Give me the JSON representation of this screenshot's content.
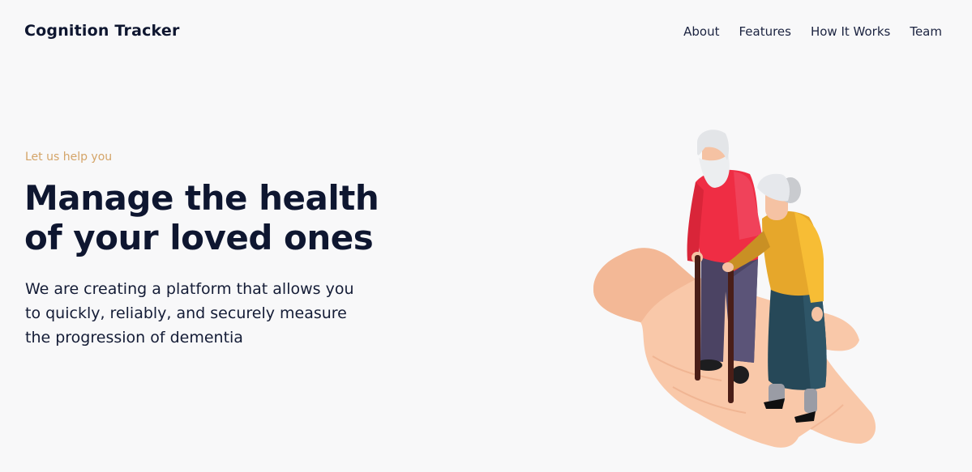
{
  "header": {
    "brand": "Cognition Tracker",
    "nav": [
      "About",
      "Features",
      "How It Works",
      "Team"
    ]
  },
  "hero": {
    "eyebrow": "Let us help you",
    "headline_line1": "Manage the health",
    "headline_line2": "of your loved ones",
    "lead_line1": "We are creating a platform that allows you",
    "lead_line2": "to quickly, reliably, and securely measure",
    "lead_line3": "the progression of dementia"
  },
  "colors": {
    "background": "#f8f8f9",
    "text": "#0e1630",
    "accent": "#d4a468"
  },
  "illustration": "elderly-couple-on-hand"
}
